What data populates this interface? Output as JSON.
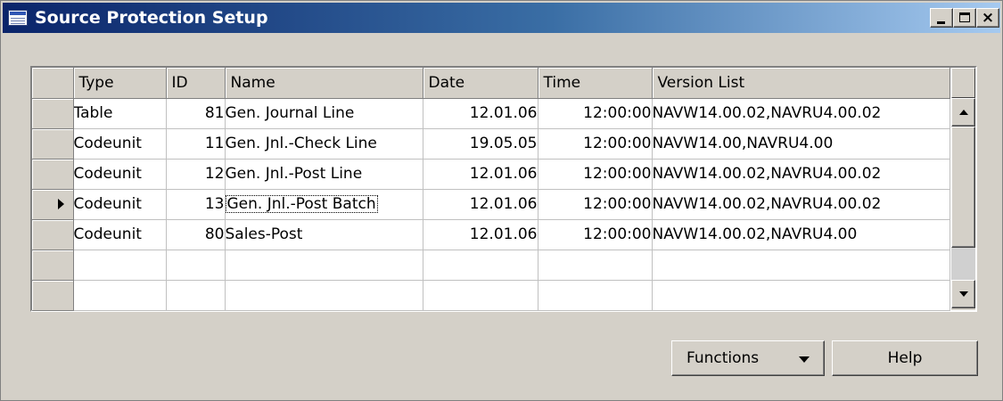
{
  "window": {
    "title": "Source Protection Setup",
    "controls": {
      "minimize": "_",
      "maximize": "□",
      "close": "×"
    }
  },
  "table": {
    "columns": [
      "Type",
      "ID",
      "Name",
      "Date",
      "Time",
      "Version List"
    ],
    "rows": [
      {
        "type": "Table",
        "id": "81",
        "name": "Gen. Journal Line",
        "date": "12.01.06",
        "time": "12:00:00",
        "version": "NAVW14.00.02,NAVRU4.00.02"
      },
      {
        "type": "Codeunit",
        "id": "11",
        "name": "Gen. Jnl.-Check Line",
        "date": "19.05.05",
        "time": "12:00:00",
        "version": "NAVW14.00,NAVRU4.00"
      },
      {
        "type": "Codeunit",
        "id": "12",
        "name": "Gen. Jnl.-Post Line",
        "date": "12.01.06",
        "time": "12:00:00",
        "version": "NAVW14.00.02,NAVRU4.00.02"
      },
      {
        "type": "Codeunit",
        "id": "13",
        "name": "Gen. Jnl.-Post Batch",
        "date": "12.01.06",
        "time": "12:00:00",
        "version": "NAVW14.00.02,NAVRU4.00.02"
      },
      {
        "type": "Codeunit",
        "id": "80",
        "name": "Sales-Post",
        "date": "12.01.06",
        "time": "12:00:00",
        "version": "NAVW14.00.02,NAVRU4.00"
      }
    ],
    "current_row_index": 3
  },
  "buttons": {
    "functions_label": "Functions",
    "help_label": "Help"
  },
  "colors": {
    "title_gradient_start": "#0a246a",
    "title_gradient_end": "#a6caf0",
    "face": "#d4d0c8"
  },
  "icons": [
    "window-app-icon",
    "row-pointer-icon",
    "dropdown-arrow-icon",
    "scroll-up-icon",
    "scroll-down-icon"
  ]
}
